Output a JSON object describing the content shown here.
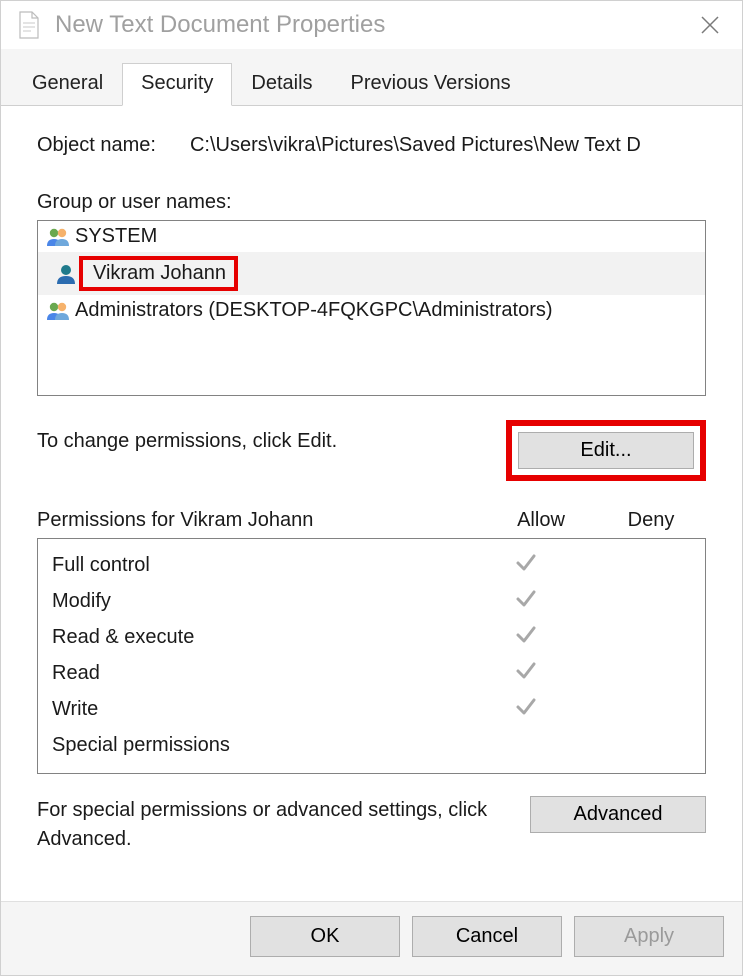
{
  "window": {
    "title": "New Text Document Properties"
  },
  "tabs": [
    {
      "label": "General"
    },
    {
      "label": "Security"
    },
    {
      "label": "Details"
    },
    {
      "label": "Previous Versions"
    }
  ],
  "active_tab": "Security",
  "object": {
    "label": "Object name:",
    "value": "C:\\Users\\vikra\\Pictures\\Saved Pictures\\New Text D"
  },
  "groups": {
    "label": "Group or user names:",
    "items": [
      {
        "name": "SYSTEM",
        "icon": "group"
      },
      {
        "name": "Vikram Johann",
        "icon": "user",
        "highlighted": true,
        "selected": true
      },
      {
        "name": "Administrators (DESKTOP-4FQKGPC\\Administrators)",
        "icon": "group"
      }
    ]
  },
  "edit": {
    "hint": "To change permissions, click Edit.",
    "button": "Edit..."
  },
  "permissions": {
    "header_name": "Permissions for Vikram Johann",
    "col_allow": "Allow",
    "col_deny": "Deny",
    "rows": [
      {
        "name": "Full control",
        "allow": true,
        "deny": false
      },
      {
        "name": "Modify",
        "allow": true,
        "deny": false
      },
      {
        "name": "Read & execute",
        "allow": true,
        "deny": false
      },
      {
        "name": "Read",
        "allow": true,
        "deny": false
      },
      {
        "name": "Write",
        "allow": true,
        "deny": false
      },
      {
        "name": "Special permissions",
        "allow": false,
        "deny": false
      }
    ]
  },
  "advanced": {
    "hint": "For special permissions or advanced settings, click Advanced.",
    "button": "Advanced"
  },
  "footer": {
    "ok": "OK",
    "cancel": "Cancel",
    "apply": "Apply"
  }
}
